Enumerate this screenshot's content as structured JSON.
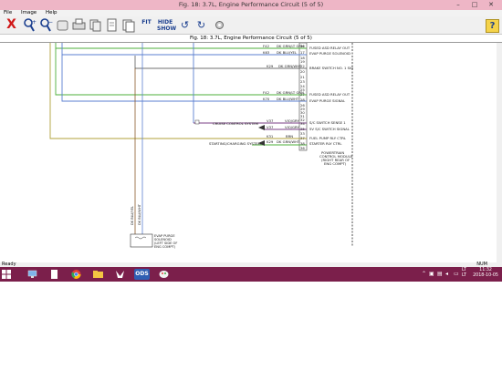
{
  "window": {
    "title": "Fig. 18: 3.7L, Engine Performance Circuit (5 of 5)",
    "minimize": "–",
    "maximize": "□",
    "close": "✕"
  },
  "menu": {
    "file": "File",
    "image": "Image",
    "help": "Help"
  },
  "toolbar": {
    "exit": "X",
    "zoom_in": "🔍+",
    "zoom_out": "🔍−",
    "fit": "FIT",
    "hide_show_line1": "HIDE",
    "hide_show_line2": "SHOW",
    "rotate_left": "↺",
    "rotate_right": "↻",
    "help": "?"
  },
  "document_header": "Fig. 18: 3.7L, Engine Performance Circuit (5 of 5)",
  "diagram": {
    "wires": [
      {
        "cav": "16",
        "color_label": "DK GRN/LT GRN",
        "circuit": "F42"
      },
      {
        "cav": "17",
        "color_label": "DK BLU/YEL",
        "circuit": "K63"
      },
      {
        "cav": "22",
        "color_label": "DK GRN/WHT",
        "circuit": "K29"
      },
      {
        "cav": "27",
        "color_label": "DK GRN/LT GRN",
        "circuit": "F42"
      },
      {
        "cav": "28",
        "color_label": "DK BLU/WHT",
        "circuit": "K70"
      },
      {
        "cav": "34",
        "color_label": "VIO/GRY",
        "circuit": "V37"
      },
      {
        "cav": "35",
        "color_label": "VIO/GRY",
        "circuit": "V37"
      },
      {
        "cav": "37",
        "color_label": "BRN",
        "circuit": "K31"
      },
      {
        "cav": "38",
        "color_label": "DK GRN/WHT",
        "circuit": "K29"
      }
    ],
    "extra_cavities": [
      "18",
      "19",
      "20",
      "21",
      "23",
      "24",
      "25",
      "26",
      "29",
      "30",
      "31",
      "32",
      "33",
      "36"
    ],
    "pcm_functions": [
      "FUSED ASD RELAY OUT",
      "EVAP PURGE SOLENOID",
      "BRAKE SWITCH NO. 1 SIG",
      "FUSED ASD RELAY OUT",
      "EVAP PURGE SIGNAL",
      "S/C SWITCH SENSE 1",
      "5V S/C SWITCH SIGNAL",
      "FUEL PUMP RLY CTRL",
      "STARTER RLY CTRL"
    ],
    "pcm_label": [
      "POWERTRAIN",
      "CONTROL MODULE",
      "(RIGHT REAR OF",
      "ENG COMPT)"
    ],
    "cruise_label": "CRUISE CONTROL SYSTEM",
    "starting_label": "STARTING/CHARGING SYSTEM",
    "purge_wire_1": "DK BLU/YEL",
    "purge_wire_2": "DK BLU/WHT",
    "purge_label": [
      "EVAP PURGE",
      "SOLENOID",
      "(LEFT SIDE OF",
      "ENG COMPT)"
    ],
    "colors": {
      "green": "#4caf3a",
      "olive": "#b0a23a",
      "blue": "#5b7fd0",
      "purple": "#7a3f86",
      "brown": "#8b5a2b",
      "dark": "#333333"
    }
  },
  "status": {
    "left": "Ready",
    "right": "NUM"
  },
  "taskbar": {
    "apps": [
      "start",
      "explorer-pc",
      "file-manager",
      "chrome",
      "folder",
      "gimp",
      "ods",
      "paint"
    ],
    "ods_label": "ODS",
    "lang_top": "LT",
    "lang_bottom": "LT",
    "time": "11:32",
    "date": "2018-10-05"
  }
}
